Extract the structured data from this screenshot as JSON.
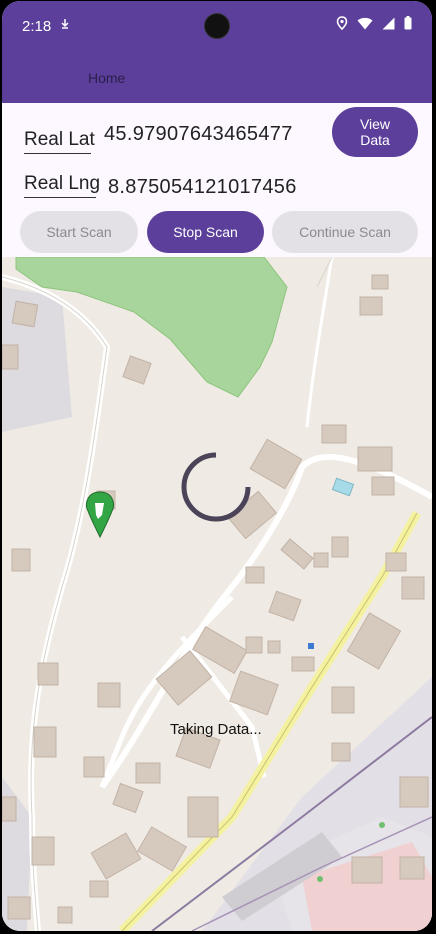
{
  "status_bar": {
    "time": "2:18",
    "icons": [
      "download-icon",
      "location-icon",
      "wifi-icon",
      "signal-icon",
      "battery-icon"
    ]
  },
  "app_bar": {
    "title": "Home"
  },
  "coordinates": {
    "lat_label": "Real Lat",
    "lat_value": "45.97907643465477",
    "lng_label": "Real Lng",
    "lng_value": "8.875054121017456"
  },
  "buttons": {
    "view_data": "View Data",
    "start_scan": "Start Scan",
    "stop_scan": "Stop Scan",
    "continue_scan": "Continue Scan"
  },
  "map": {
    "overlay_text": "Taking Data...",
    "marker_icon": "map-pin-icon"
  },
  "colors": {
    "primary": "#5b3f9a",
    "disabled_bg": "#e3e1e6",
    "disabled_text": "#8c8a91"
  }
}
